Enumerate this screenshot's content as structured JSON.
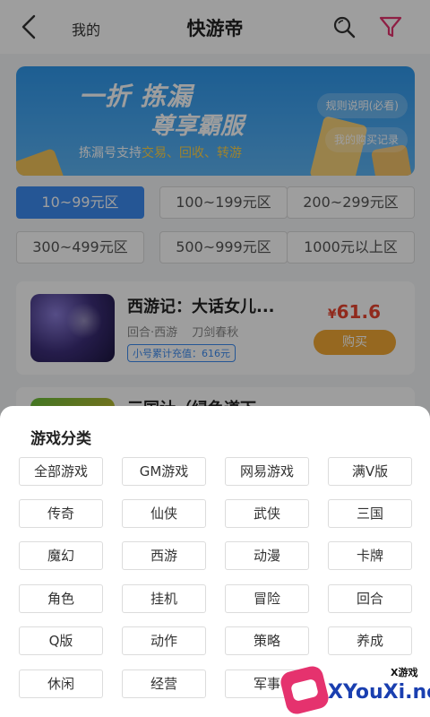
{
  "header": {
    "mine_label": "我的",
    "title": "快游帝"
  },
  "banner": {
    "line1": "一折 拣漏",
    "line2": "尊享霸服",
    "sub_prefix": "拣漏号支持",
    "sub_highlight": "交易、回收、转游",
    "rules_button": "规则说明(必看)",
    "records_button": "我的购买记录"
  },
  "zones": [
    "10~99元区",
    "100~199元区",
    "200~299元区",
    "300~499元区",
    "500~999元区",
    "1000元以上区"
  ],
  "listing": {
    "name": "西游记：大话女儿...",
    "tags": [
      "回合·西游",
      "刀剑春秋"
    ],
    "recharge": "小号累计充值：616元",
    "currency": "¥",
    "price": "61.6",
    "buy_label": "购买"
  },
  "listing2": {
    "name": "三国计（绿色道下"
  },
  "category_sheet": {
    "title": "游戏分类",
    "items": [
      "全部游戏",
      "GM游戏",
      "网易游戏",
      "满V版",
      "传奇",
      "仙侠",
      "武侠",
      "三国",
      "魔幻",
      "西游",
      "动漫",
      "卡牌",
      "角色",
      "挂机",
      "冒险",
      "回合",
      "Q版",
      "动作",
      "策略",
      "养成",
      "休闲",
      "经营",
      "军事"
    ]
  },
  "watermark": {
    "tag": "X游戏",
    "site": "XYouXi.net"
  },
  "colors": {
    "accent": "#3d8cf0",
    "price": "#e8442f",
    "buy": "#f2a935",
    "filter_icon": "#e5326e"
  }
}
